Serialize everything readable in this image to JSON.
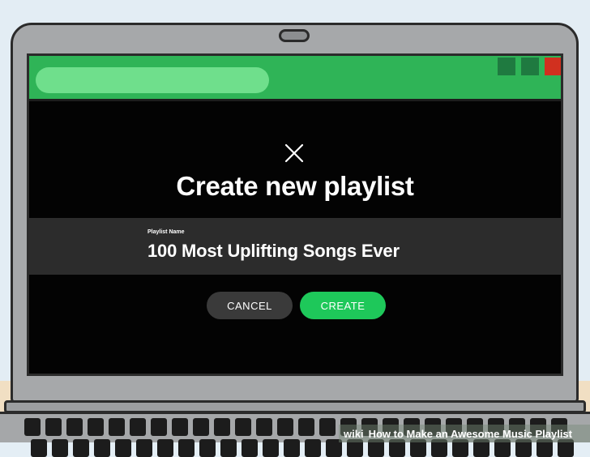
{
  "dialog": {
    "title": "Create new playlist",
    "field_label": "Playlist Name",
    "field_value": "100 Most Uplifting Songs Ever",
    "cancel_label": "CANCEL",
    "create_label": "CREATE"
  },
  "icons": {
    "close": "close-icon",
    "window_controls": [
      "minimize-icon",
      "maximize-icon",
      "close-window-icon"
    ]
  },
  "watermark": {
    "logo": "wiki",
    "text": "How to Make an Awesome Music Playlist"
  },
  "colors": {
    "brand_green": "#2fb457",
    "create_button": "#1ec85a",
    "cancel_button": "#3a3a3a",
    "window_close": "#d1301f"
  }
}
